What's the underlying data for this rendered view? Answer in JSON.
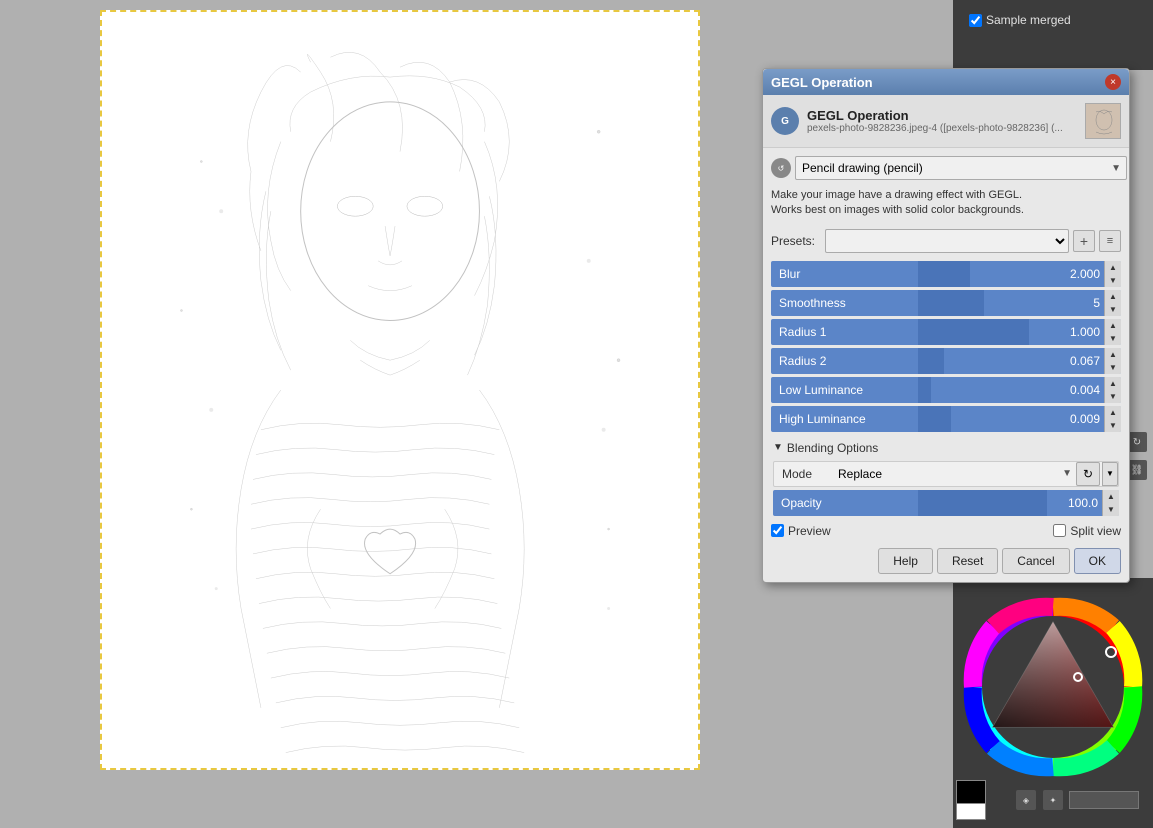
{
  "dialog": {
    "title": "GEGL Operation",
    "header_title": "GEGL Operation",
    "header_subtitle": "pexels-photo-9828236.jpeg-4 ([pexels-photo-9828236] (...",
    "description": "Make your image have a drawing effect with GEGL.\nWorks best on images with solid color backgrounds.",
    "operation_label": "Pencil drawing (pencil)",
    "presets_label": "Presets:",
    "close_btn": "×",
    "params": [
      {
        "label": "Blur",
        "value": "2.000",
        "fill_pct": 40
      },
      {
        "label": "Smoothness",
        "value": "5",
        "fill_pct": 50
      },
      {
        "label": "Radius 1",
        "value": "1.000",
        "fill_pct": 85
      },
      {
        "label": "Radius 2",
        "value": "0.067",
        "fill_pct": 20
      },
      {
        "label": "Low Luminance",
        "value": "0.004",
        "fill_pct": 10
      },
      {
        "label": "High Luminance",
        "value": "0.009",
        "fill_pct": 25
      }
    ],
    "blending_header": "Blending Options",
    "mode_label": "Mode",
    "mode_value": "Replace",
    "opacity_label": "Opacity",
    "opacity_value": "100.0",
    "opacity_fill_pct": 100,
    "preview_label": "Preview",
    "split_view_label": "Split view",
    "preview_checked": true,
    "split_view_checked": false,
    "btn_help": "Help",
    "btn_reset": "Reset",
    "btn_cancel": "Cancel",
    "btn_ok": "OK"
  },
  "right_panel": {
    "sample_merged_label": "Sample merged",
    "color_hex": "000000"
  },
  "icons": {
    "close": "×",
    "up_arrow": "▲",
    "down_arrow": "▼",
    "collapse": "▼",
    "add": "+",
    "manage": "≡",
    "refresh": "↻",
    "chain": "⛓"
  }
}
